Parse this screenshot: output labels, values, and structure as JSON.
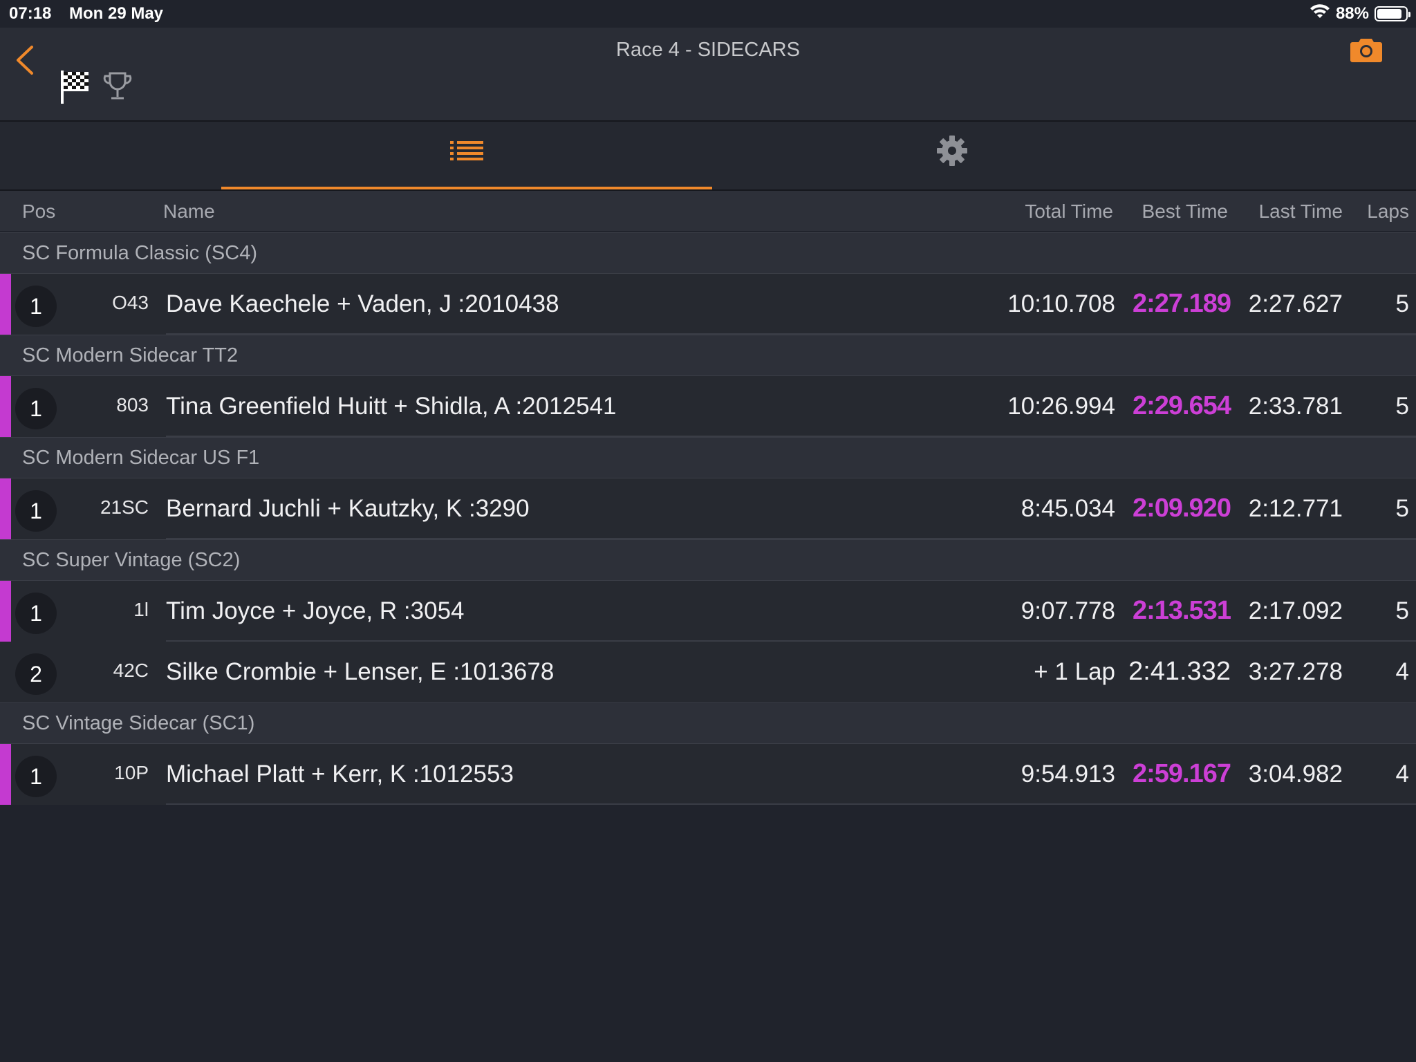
{
  "status_bar": {
    "time": "07:18",
    "date": "Mon 29 May",
    "battery": "88%",
    "battery_level": 0.88
  },
  "header": {
    "title": "Race 4 - SIDECARS"
  },
  "columns": {
    "pos": "Pos",
    "name": "Name",
    "total": "Total Time",
    "best": "Best Time",
    "last": "Last Time",
    "laps": "Laps"
  },
  "groups": [
    {
      "name": "SC Formula Classic (SC4)",
      "rows": [
        {
          "pos": "1",
          "num": "O43",
          "name": "Dave Kaechele + Vaden, J :2010438",
          "total": "10:10.708",
          "best": "2:27.189",
          "last": "2:27.627",
          "laps": "5"
        }
      ]
    },
    {
      "name": "SC Modern Sidecar TT2",
      "rows": [
        {
          "pos": "1",
          "num": "803",
          "name": "Tina Greenfield Huitt + Shidla, A :2012541",
          "total": "10:26.994",
          "best": "2:29.654",
          "last": "2:33.781",
          "laps": "5"
        }
      ]
    },
    {
      "name": "SC Modern Sidecar US F1",
      "rows": [
        {
          "pos": "1",
          "num": "21SC",
          "name": "Bernard Juchli + Kautzky, K :3290",
          "total": "8:45.034",
          "best": "2:09.920",
          "last": "2:12.771",
          "laps": "5"
        }
      ]
    },
    {
      "name": "SC Super Vintage (SC2)",
      "rows": [
        {
          "pos": "1",
          "num": "1l",
          "name": "Tim Joyce + Joyce, R :3054",
          "total": "9:07.778",
          "best": "2:13.531",
          "last": "2:17.092",
          "laps": "5"
        },
        {
          "pos": "2",
          "num": "42C",
          "name": "Silke Crombie + Lenser, E :1013678",
          "total": "+ 1 Lap",
          "best": "2:41.332",
          "last": "3:27.278",
          "laps": "4"
        }
      ]
    },
    {
      "name": "SC Vintage Sidecar (SC1)",
      "rows": [
        {
          "pos": "1",
          "num": "10P",
          "name": "Michael Platt + Kerr, K :1012553",
          "total": "9:54.913",
          "best": "2:59.167",
          "last": "3:04.982",
          "laps": "4"
        }
      ]
    }
  ],
  "colors": {
    "accent": "#f0892b",
    "personal_best": "#cc3fd6",
    "background": "#20232c"
  }
}
